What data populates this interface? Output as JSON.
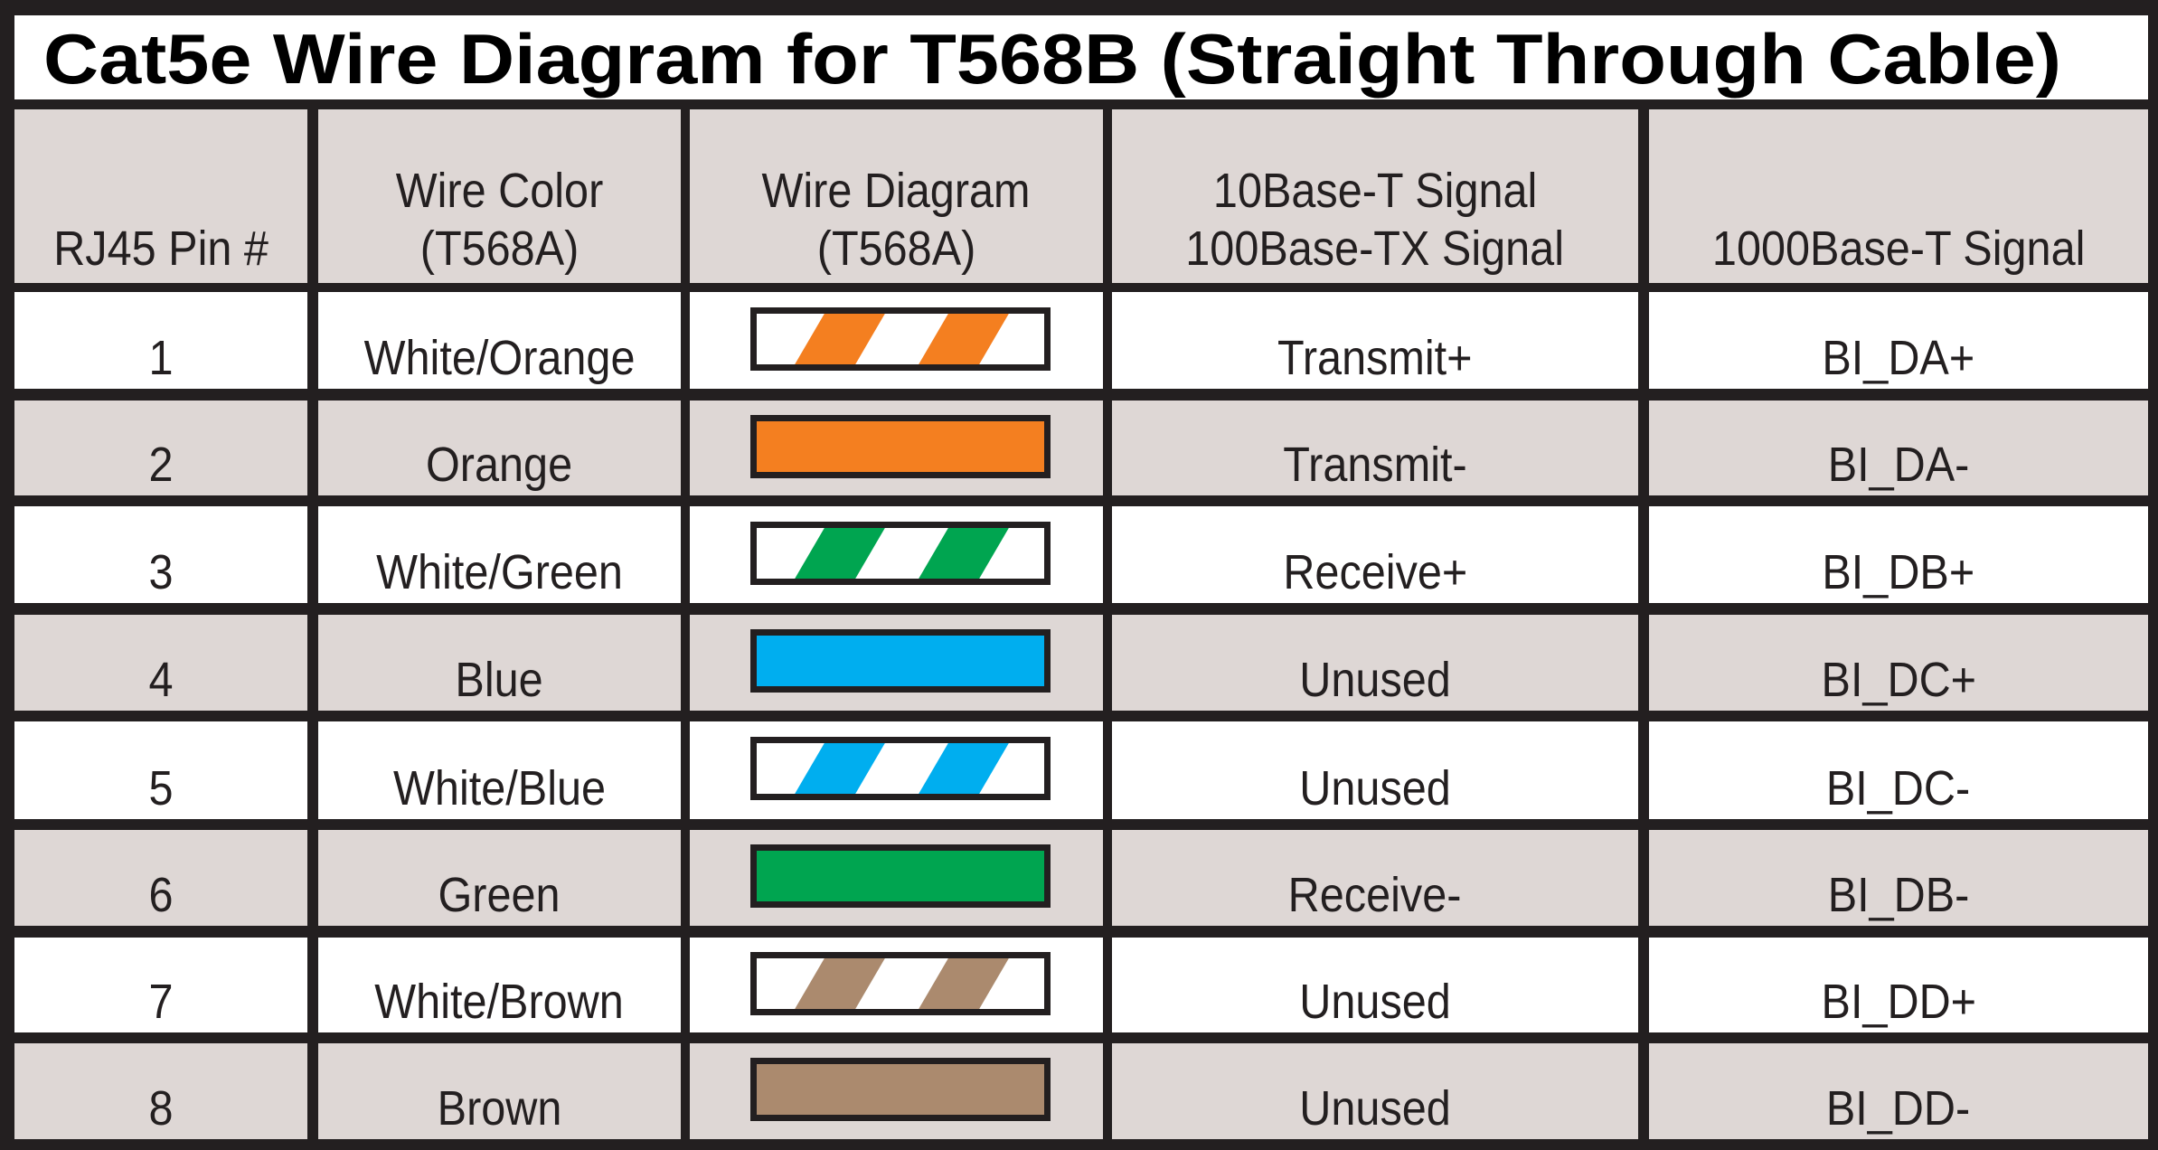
{
  "title": "Cat5e Wire Diagram for T568B (Straight Through Cable)",
  "table": {
    "headers": [
      {
        "lines": [
          "RJ45 Pin #"
        ]
      },
      {
        "lines": [
          "Wire Color",
          "(T568A)"
        ]
      },
      {
        "lines": [
          "Wire Diagram",
          "(T568A)"
        ]
      },
      {
        "lines": [
          "10Base-T Signal",
          "100Base-TX Signal"
        ]
      },
      {
        "lines": [
          "1000Base-T Signal"
        ]
      }
    ],
    "rows": [
      {
        "pin": "1",
        "color": "White/Orange",
        "wire": {
          "pattern": "striped",
          "color": "#F47F20",
          "icon": "wire-white-orange-icon"
        },
        "signal_10_100": "Transmit+",
        "signal_1000": "BI_DA+"
      },
      {
        "pin": "2",
        "color": "Orange",
        "wire": {
          "pattern": "solid",
          "color": "#F47F20",
          "icon": "wire-orange-icon"
        },
        "signal_10_100": "Transmit-",
        "signal_1000": "BI_DA-"
      },
      {
        "pin": "3",
        "color": "White/Green",
        "wire": {
          "pattern": "striped",
          "color": "#00A550",
          "icon": "wire-white-green-icon"
        },
        "signal_10_100": "Receive+",
        "signal_1000": "BI_DB+"
      },
      {
        "pin": "4",
        "color": "Blue",
        "wire": {
          "pattern": "solid",
          "color": "#00AEEF",
          "icon": "wire-blue-icon"
        },
        "signal_10_100": "Unused",
        "signal_1000": "BI_DC+"
      },
      {
        "pin": "5",
        "color": "White/Blue",
        "wire": {
          "pattern": "striped",
          "color": "#00AEEF",
          "icon": "wire-white-blue-icon"
        },
        "signal_10_100": "Unused",
        "signal_1000": "BI_DC-"
      },
      {
        "pin": "6",
        "color": "Green",
        "wire": {
          "pattern": "solid",
          "color": "#00A550",
          "icon": "wire-green-icon"
        },
        "signal_10_100": "Receive-",
        "signal_1000": "BI_DB-"
      },
      {
        "pin": "7",
        "color": "White/Brown",
        "wire": {
          "pattern": "striped",
          "color": "#AB8A6E",
          "icon": "wire-white-brown-icon"
        },
        "signal_10_100": "Unused",
        "signal_1000": "BI_DD+"
      },
      {
        "pin": "8",
        "color": "Brown",
        "wire": {
          "pattern": "solid",
          "color": "#AB8A6E",
          "icon": "wire-brown-icon"
        },
        "signal_10_100": "Unused",
        "signal_1000": "BI_DD-"
      }
    ]
  },
  "colors": {
    "border": "#231F20",
    "row_gray": "#DED7D5",
    "row_white": "#FFFFFF"
  }
}
